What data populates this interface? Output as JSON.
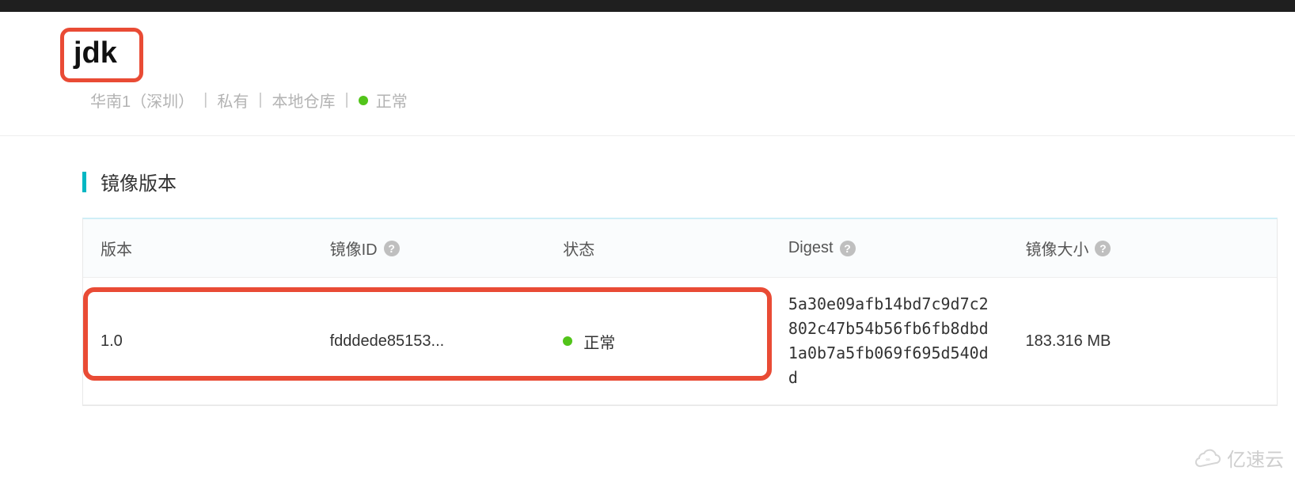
{
  "header": {
    "title": "jdk",
    "meta": {
      "region": "华南1（深圳）",
      "visibility": "私有",
      "repoType": "本地仓库",
      "status": "正常",
      "separator": "|"
    }
  },
  "section": {
    "title": "镜像版本"
  },
  "table": {
    "headers": {
      "version": "版本",
      "imageId": "镜像ID",
      "status": "状态",
      "digest": "Digest",
      "size": "镜像大小"
    },
    "helpGlyph": "?",
    "rows": [
      {
        "version": "1.0",
        "imageId": "fdddede85153...",
        "status": "正常",
        "digest": "5a30e09afb14bd7c9d7c2802c47b54b56fb6fb8dbd1a0b7a5fb069f695d540dd",
        "size": "183.316 MB"
      }
    ]
  },
  "watermark": {
    "text": "亿速云"
  },
  "colors": {
    "highlight": "#e94b35",
    "statusDot": "#52c41a",
    "accentBar": "#00b7c3"
  }
}
